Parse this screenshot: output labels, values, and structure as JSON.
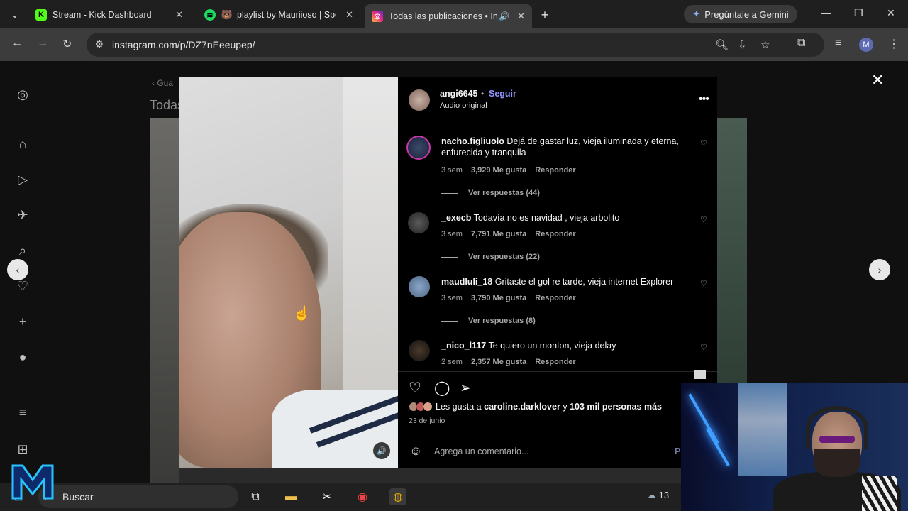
{
  "browser": {
    "tabs": [
      {
        "title": "Stream - Kick Dashboard",
        "favicon": "K",
        "color": "#53fc18"
      },
      {
        "title": "playlist by Mauriioso | Spo",
        "favicon": "spotify-icon",
        "color": "#1ed760"
      },
      {
        "title": "Todas las publicaciones • In",
        "favicon": "instagram-icon",
        "color": "#e1306c"
      }
    ],
    "gemini_label": "Pregúntale a Gemini",
    "url": "instagram.com/p/DZ7nEeeupep/",
    "profile_initial": "M"
  },
  "page_bg": {
    "breadcrumb": "Gua",
    "title": "Todas"
  },
  "post": {
    "username": "angi6645",
    "separator": "•",
    "follow_label": "Seguir",
    "audio": "Audio original",
    "comments": [
      {
        "user": "nacho.figliuolo",
        "text": "Dejá de gastar luz, vieja iluminada y eterna, enfurecida y tranquila",
        "age": "3 sem",
        "likes": "3,929 Me gusta",
        "reply": "Responder",
        "replies": "Ver respuestas (44)"
      },
      {
        "user": "_execb",
        "text": "Todavía no es navidad , vieja arbolito",
        "age": "3 sem",
        "likes": "7,791 Me gusta",
        "reply": "Responder",
        "replies": "Ver respuestas (22)"
      },
      {
        "user": "maudluli_18",
        "text": "Gritaste el gol re tarde, vieja internet Explorer",
        "age": "3 sem",
        "likes": "3,790 Me gusta",
        "reply": "Responder",
        "replies": "Ver respuestas (8)"
      },
      {
        "user": "_nico_l117",
        "text": "Te quiero un monton, vieja delay",
        "age": "2 sem",
        "likes": "2,357 Me gusta",
        "reply": "Responder",
        "replies": ""
      }
    ],
    "likes_prefix": "Les gusta a",
    "likes_user": "caroline.darklover",
    "likes_connector": "y",
    "likes_rest": "103 mil personas más",
    "date": "23 de junio",
    "add_comment_placeholder": "Agrega un comentario...",
    "publish_label": "Pu"
  },
  "taskbar": {
    "search_label": "Buscar",
    "weather": "13"
  }
}
